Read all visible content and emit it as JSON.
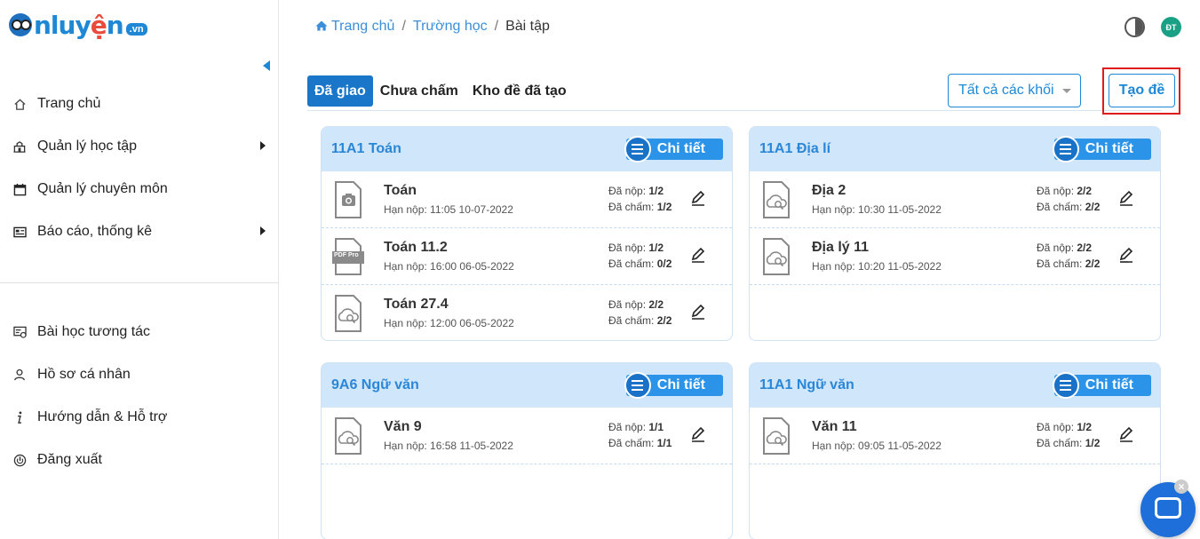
{
  "logo": {
    "brand_prefix": "nluy",
    "brand_accent": "ệ",
    "brand_suffix": "n",
    "domain": ".vn"
  },
  "sidebar": {
    "items_top": [
      {
        "label": "Trang chủ",
        "icon": "home-icon",
        "has_submenu": false
      },
      {
        "label": "Quản lý học tập",
        "icon": "school-icon",
        "has_submenu": true
      },
      {
        "label": "Quản lý chuyên môn",
        "icon": "calendar-icon",
        "has_submenu": false
      },
      {
        "label": "Báo cáo, thống kê",
        "icon": "report-icon",
        "has_submenu": true
      }
    ],
    "items_bottom": [
      {
        "label": "Bài học tương tác",
        "icon": "interactive-lesson-icon"
      },
      {
        "label": "Hồ sơ cá nhân",
        "icon": "user-icon"
      },
      {
        "label": "Hướng dẫn & Hỗ trợ",
        "icon": "info-icon"
      },
      {
        "label": "Đăng xuất",
        "icon": "power-icon"
      }
    ]
  },
  "breadcrumb": {
    "home": "Trang chủ",
    "school": "Trường học",
    "current": "Bài tập",
    "separator": "/"
  },
  "header": {
    "avatar_initials": "ĐT"
  },
  "tabs": [
    {
      "label": "Đã giao",
      "active": true
    },
    {
      "label": "Chưa chấm",
      "active": false
    },
    {
      "label": "Kho đề đã tạo",
      "active": false
    }
  ],
  "filter": {
    "grade_select": "Tất cả các khối"
  },
  "create_button": "Tạo đề",
  "detail_label": "Chi tiết",
  "stat_labels": {
    "submitted": "Đã nộp: ",
    "graded": "Đã chấm: "
  },
  "deadline_label": "Hạn nộp: ",
  "classes": [
    {
      "title": "11A1 Toán",
      "assignments": [
        {
          "name": "Toán",
          "deadline": "11:05 10-07-2022",
          "submitted": "1/2",
          "graded": "1/2",
          "icon": "camera-file-icon"
        },
        {
          "name": "Toán 11.2",
          "deadline": "16:00 06-05-2022",
          "submitted": "1/2",
          "graded": "0/2",
          "icon": "pdf-file-icon"
        },
        {
          "name": "Toán 27.4",
          "deadline": "12:00 06-05-2022",
          "submitted": "2/2",
          "graded": "2/2",
          "icon": "cloud-search-file-icon"
        }
      ]
    },
    {
      "title": "11A1 Địa lí",
      "assignments": [
        {
          "name": "Địa 2",
          "deadline": "10:30 11-05-2022",
          "submitted": "2/2",
          "graded": "2/2",
          "icon": "cloud-search-file-icon"
        },
        {
          "name": "Địa lý 11",
          "deadline": "10:20 11-05-2022",
          "submitted": "2/2",
          "graded": "2/2",
          "icon": "cloud-search-file-icon"
        }
      ]
    },
    {
      "title": "9A6 Ngữ văn",
      "assignments": [
        {
          "name": "Văn 9",
          "deadline": "16:58 11-05-2022",
          "submitted": "1/1",
          "graded": "1/1",
          "icon": "cloud-search-file-icon"
        }
      ]
    },
    {
      "title": "11A1 Ngữ văn",
      "assignments": [
        {
          "name": "Văn 11",
          "deadline": "09:05 11-05-2022",
          "submitted": "1/2",
          "graded": "1/2",
          "icon": "cloud-search-file-icon"
        }
      ]
    }
  ],
  "pdf_badge": "PDF Pro",
  "chat_close": "×",
  "colors": {
    "primary": "#1976c9",
    "accent": "#2b93e8",
    "card_header": "#cfe6fb",
    "highlight_box": "#e01b1b",
    "avatar": "#1aa085"
  }
}
